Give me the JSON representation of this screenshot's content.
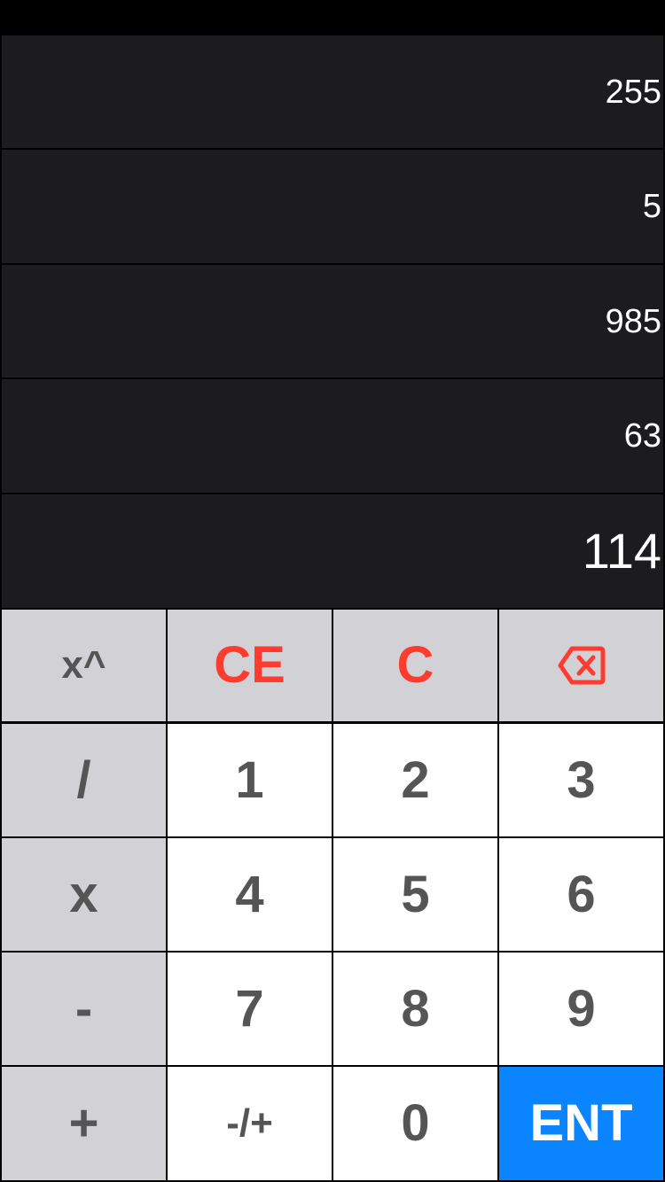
{
  "stack": {
    "rows": [
      "255",
      "5",
      "985",
      "63"
    ],
    "current": "114"
  },
  "keypad": {
    "row1": {
      "power": "x^",
      "ce": "CE",
      "clear": "C",
      "backspace_icon": "backspace-icon"
    },
    "divide": "/",
    "multiply": "x",
    "subtract": "-",
    "add": "+",
    "digits": {
      "d1": "1",
      "d2": "2",
      "d3": "3",
      "d4": "4",
      "d5": "5",
      "d6": "6",
      "d7": "7",
      "d8": "8",
      "d9": "9",
      "d0": "0"
    },
    "negate": "-/+",
    "enter": "ENT"
  },
  "colors": {
    "display_bg": "#1c1c1e",
    "operator_bg": "#d1d1d6",
    "digit_bg": "#ffffff",
    "key_text": "#555555",
    "clear_red": "#ff3b30",
    "enter_blue": "#0a84ff"
  }
}
